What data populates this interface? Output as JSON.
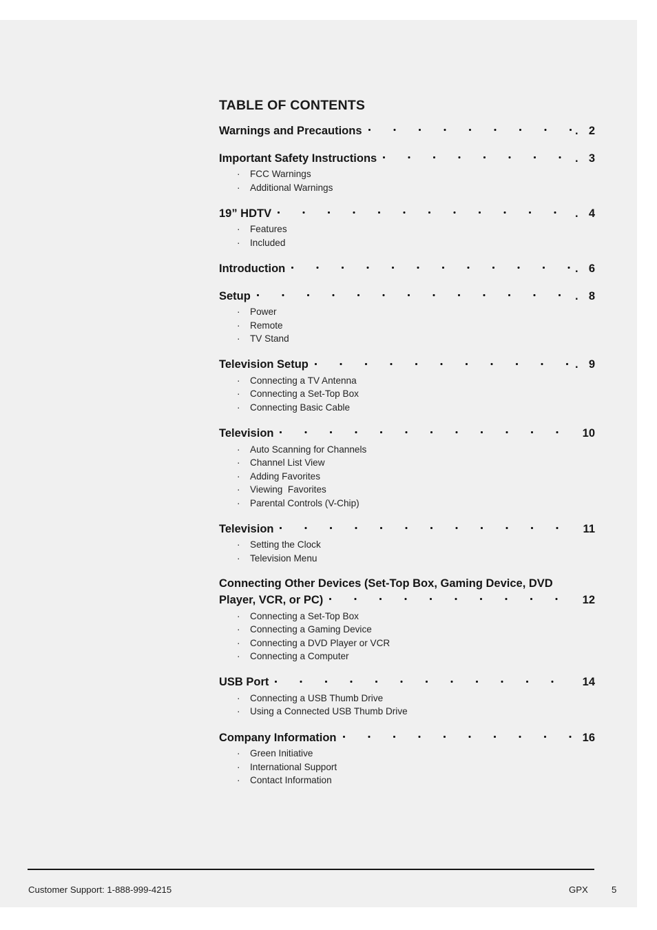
{
  "page": {
    "title": "TABLE OF CONTENTS",
    "background_color": "#f0f0f0",
    "text_color": "#151515"
  },
  "sections": [
    {
      "title": "Warnings and Precautions",
      "page": "2",
      "items": []
    },
    {
      "title": "Important Safety Instructions",
      "page": "3",
      "items": [
        "FCC Warnings",
        "Additional Warnings"
      ]
    },
    {
      "title": "19” HDTV",
      "page": "4",
      "items": [
        "Features",
        "Included"
      ]
    },
    {
      "title": "Introduction",
      "page": "6",
      "items": []
    },
    {
      "title": "Setup",
      "page": "8",
      "items": [
        "Power",
        "Remote",
        "TV Stand"
      ]
    },
    {
      "title": "Television Setup",
      "page": "9",
      "items": [
        "Connecting a TV Antenna",
        "Connecting a Set-Top Box",
        "Connecting Basic Cable"
      ]
    },
    {
      "title": "Television",
      "page": "10",
      "items": [
        "Auto Scanning for Channels",
        "Channel List View",
        "Adding Favorites",
        "Viewing  Favorites",
        "Parental Controls (V-Chip)"
      ]
    },
    {
      "title": "Television",
      "page": "11",
      "items": [
        "Setting the Clock",
        "Television Menu"
      ]
    },
    {
      "title_line_1": "Connecting Other Devices (Set-Top Box, Gaming Device, DVD",
      "title_line_2": "Player, VCR, or PC)",
      "page": "12",
      "items": [
        "Connecting a Set-Top Box",
        "Connecting a Gaming Device",
        "Connecting a DVD Player or VCR",
        "Connecting a Computer"
      ]
    },
    {
      "title": "USB Port",
      "page": "14",
      "items": [
        "Connecting a USB Thumb Drive",
        "Using a Connected USB Thumb Drive"
      ]
    },
    {
      "title": "Company Information",
      "page": "16",
      "items": [
        "Green Initiative",
        "International Support",
        "Contact Information"
      ]
    }
  ],
  "bullet_glyph": "·",
  "leader_tail_dot": ".",
  "footer": {
    "support": "Customer Support: 1-888-999-4215",
    "brand": "GPX",
    "page_number": "5"
  }
}
